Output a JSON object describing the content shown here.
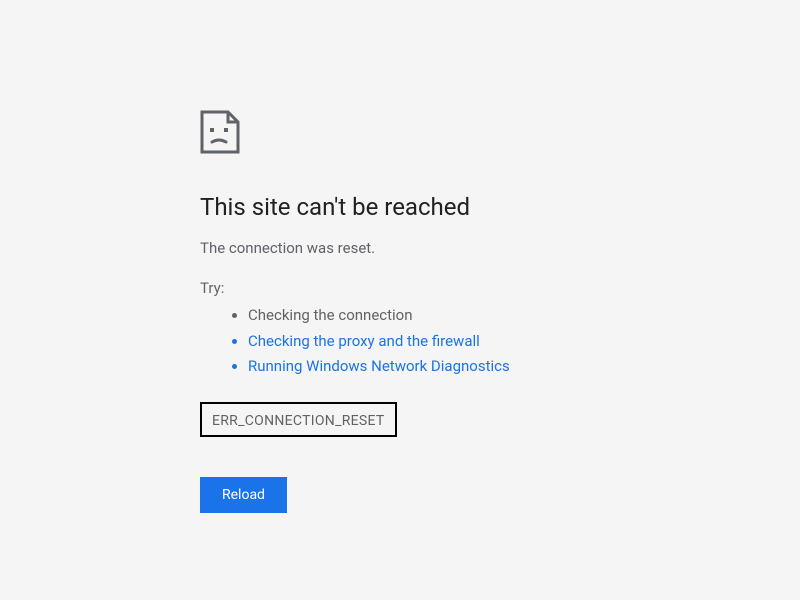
{
  "error": {
    "title": "This site can't be reached",
    "message": "The connection was reset.",
    "try_label": "Try:",
    "suggestions": {
      "check_connection": "Checking the connection",
      "check_proxy": "Checking the proxy and the firewall",
      "run_diagnostics": "Running Windows Network Diagnostics"
    },
    "code": "ERR_CONNECTION_RESET",
    "reload_label": "Reload"
  }
}
